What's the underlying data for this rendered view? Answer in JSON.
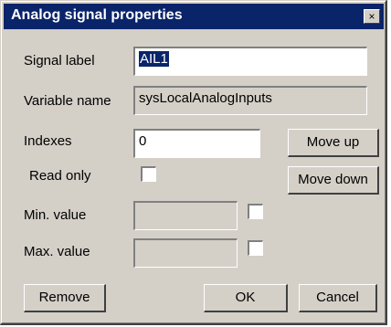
{
  "window": {
    "title": "Analog signal properties",
    "close_glyph": "×"
  },
  "form": {
    "signal_label": {
      "label": "Signal label",
      "value": "AIL1"
    },
    "variable_name": {
      "label": "Variable name",
      "value": "sysLocalAnalogInputs"
    },
    "indexes": {
      "label": "Indexes",
      "value": "0"
    },
    "read_only": {
      "label": "Read only",
      "checked": false
    },
    "min_value": {
      "label": "Min. value",
      "value": "",
      "checked": false
    },
    "max_value": {
      "label": "Max. value",
      "value": "",
      "checked": false
    }
  },
  "buttons": {
    "move_up": "Move up",
    "move_down": "Move down",
    "remove": "Remove",
    "ok": "OK",
    "cancel": "Cancel"
  },
  "colors": {
    "title_bar": "#0a246a",
    "dialog_face": "#d4d0c8",
    "selection": "#0a246a"
  }
}
